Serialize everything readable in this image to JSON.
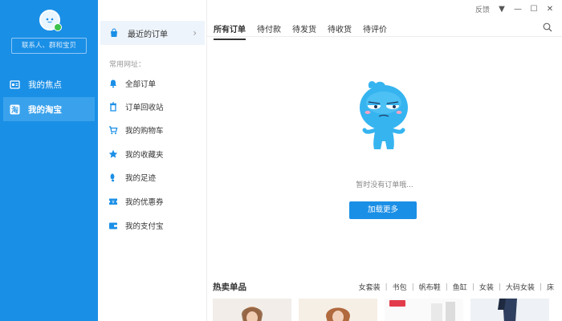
{
  "window": {
    "feedback": "反馈"
  },
  "sidebar": {
    "search_placeholder": "联系人、群和宝贝",
    "items": [
      {
        "label": "我的焦点"
      },
      {
        "label": "我的淘宝"
      }
    ]
  },
  "nav": {
    "recent_orders": "最近的订单",
    "section_title": "常用网址：",
    "items": [
      {
        "label": "全部订单",
        "icon": "bell-icon"
      },
      {
        "label": "订单回收站",
        "icon": "trash-icon"
      },
      {
        "label": "我的购物车",
        "icon": "cart-icon"
      },
      {
        "label": "我的收藏夹",
        "icon": "star-icon"
      },
      {
        "label": "我的足迹",
        "icon": "footprint-icon"
      },
      {
        "label": "我的优惠券",
        "icon": "coupon-icon"
      },
      {
        "label": "我的支付宝",
        "icon": "wallet-icon"
      }
    ]
  },
  "main": {
    "tabs": [
      {
        "label": "所有订单"
      },
      {
        "label": "待付款"
      },
      {
        "label": "待发货"
      },
      {
        "label": "待收货"
      },
      {
        "label": "待评价"
      }
    ],
    "empty_text": "暂时没有订单哦...",
    "load_more": "加载更多",
    "hot_title": "热卖单品",
    "hot_tags": [
      "女套装",
      "书包",
      "帆布鞋",
      "鱼缸",
      "女装",
      "大码女装",
      "床"
    ]
  },
  "colors": {
    "accent": "#1a8fe6",
    "sidebar_active": "#3aa2ec",
    "recent_bg": "#eef4fb"
  }
}
